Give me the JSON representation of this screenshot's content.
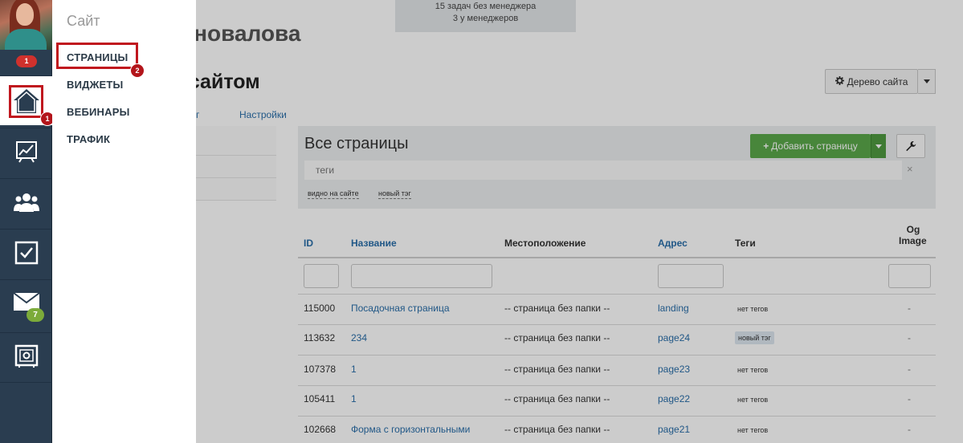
{
  "rail": {
    "notification_count": "1",
    "mail_count": "7",
    "items": [
      {
        "name": "home",
        "icon": "home-icon"
      },
      {
        "name": "analytics",
        "icon": "chart-icon"
      },
      {
        "name": "users",
        "icon": "users-icon"
      },
      {
        "name": "tasks",
        "icon": "checkbox-icon"
      },
      {
        "name": "mail",
        "icon": "mail-icon"
      },
      {
        "name": "safe",
        "icon": "safe-icon"
      }
    ]
  },
  "callouts": {
    "first": "1",
    "second": "2"
  },
  "submenu": {
    "title": "Сайт",
    "items": [
      "СТРАНИЦЫ",
      "ВИДЖЕТЫ",
      "ВЕБИНАРЫ",
      "ТРАФИК"
    ]
  },
  "notice": {
    "line1": "15 задач без менеджера",
    "line2": "3 у менеджеров"
  },
  "header": {
    "user_name_fragment": "оновалова",
    "heading_fragment": "е сайтом",
    "tree_button": "Дерево сайта",
    "tab_fragment": "г",
    "tab_settings": "Настройки"
  },
  "panel": {
    "title": "Все страницы",
    "add_button": "Добавить страницу",
    "tags_placeholder": "теги",
    "tags_clear": "×",
    "chips": [
      "видно на сайте",
      "новый тэг"
    ]
  },
  "table": {
    "columns": {
      "id": "ID",
      "name": "Название",
      "location": "Местоположение",
      "address": "Адрес",
      "tags": "Теги",
      "og_image_line1": "Og",
      "og_image_line2": "Image"
    },
    "rows": [
      {
        "id": "115000",
        "name": "Посадочная страница",
        "location": "-- страница без папки --",
        "address": "landing",
        "tags": "нет тегов",
        "og": "-"
      },
      {
        "id": "113632",
        "name": "234",
        "location": "-- страница без папки --",
        "address": "page24",
        "tags": "новый тэг",
        "og": "-"
      },
      {
        "id": "107378",
        "name": "1",
        "location": "-- страница без папки --",
        "address": "page23",
        "tags": "нет тегов",
        "og": "-"
      },
      {
        "id": "105411",
        "name": "1",
        "location": "-- страница без папки --",
        "address": "page22",
        "tags": "нет тегов",
        "og": "-"
      },
      {
        "id": "102668",
        "name": "Форма с горизонтальными",
        "location": "-- страница без папки --",
        "address": "page21",
        "tags": "нет тегов",
        "og": "-"
      }
    ]
  },
  "colors": {
    "rail": "#2a3d50",
    "highlight": "#c0171e",
    "link": "#2a6ea9",
    "add_button": "#5aa84a"
  }
}
